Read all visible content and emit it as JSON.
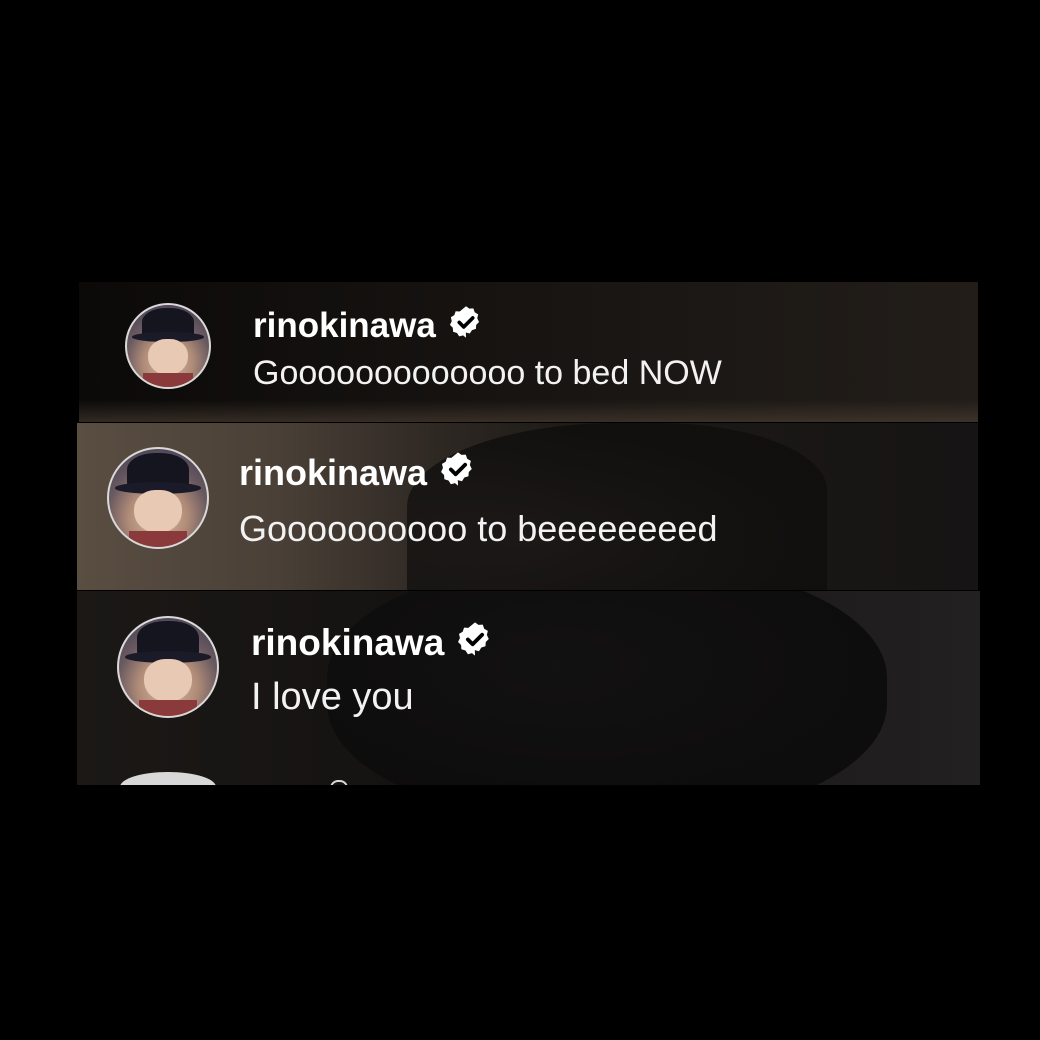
{
  "comments": [
    {
      "username": "rinokinawa",
      "verified": true,
      "message": "Gooooooooooooo to bed NOW",
      "avatar_icon": "profile-photo"
    },
    {
      "username": "rinokinawa",
      "verified": true,
      "message": "Goooooooooo to beeeeeeeed",
      "avatar_icon": "profile-photo"
    },
    {
      "username": "rinokinawa",
      "verified": true,
      "message": "I love you",
      "avatar_icon": "profile-photo"
    }
  ],
  "icons": {
    "verified": "verified-badge-icon"
  },
  "colors": {
    "background": "#000000",
    "text": "#ffffff",
    "avatar_border": "#d9d9d9"
  }
}
